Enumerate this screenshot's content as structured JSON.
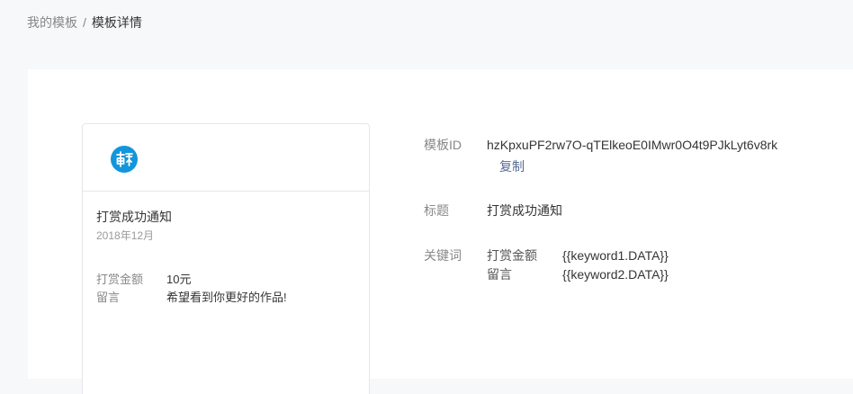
{
  "breadcrumb": {
    "parent": "我的模板",
    "separator": "/",
    "current": "模板详情"
  },
  "preview": {
    "logo_icon": "wechat-pay-logo-icon",
    "title": "打赏成功通知",
    "date": "2018年12月",
    "fields": [
      {
        "label": "打赏金额",
        "value": "10元"
      },
      {
        "label": "留言",
        "value": "希望看到你更好的作品!"
      }
    ]
  },
  "details": {
    "id_label": "模板ID",
    "id_value": "hzKpxuPF2rw7O-qTElkeoE0IMwr0O4t9PJkLyt6v8rk",
    "copy_label": "复制",
    "title_label": "标题",
    "title_value": "打赏成功通知",
    "keywords_label": "关键词",
    "keywords": [
      {
        "name": "打赏金额",
        "value": "{{keyword1.DATA}}"
      },
      {
        "name": "留言",
        "value": "{{keyword2.DATA}}"
      }
    ]
  },
  "colors": {
    "page_bg": "#f6f8f9",
    "link": "#576b95",
    "logo": "#1296db"
  }
}
